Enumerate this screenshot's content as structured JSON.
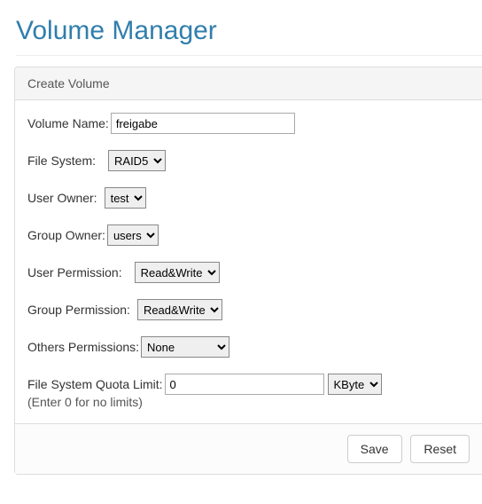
{
  "page_title": "Volume Manager",
  "panel_title": "Create Volume",
  "labels": {
    "volume_name": "Volume Name:",
    "file_system": "File System:",
    "user_owner": "User Owner:",
    "group_owner": "Group Owner:",
    "user_permission": "User Permission:",
    "group_permission": "Group Permission:",
    "others_permissions": "Others Permissions:",
    "fs_quota": "File System Quota Limit:"
  },
  "values": {
    "volume_name": "freigabe",
    "file_system": "RAID5",
    "user_owner": "test",
    "group_owner": "users",
    "user_permission": "Read&Write",
    "group_permission": "Read&Write",
    "others_permissions": "None",
    "fs_quota": "0",
    "fs_quota_unit": "KByte"
  },
  "hint": "(Enter 0 for no limits)",
  "buttons": {
    "save": "Save",
    "reset": "Reset"
  }
}
